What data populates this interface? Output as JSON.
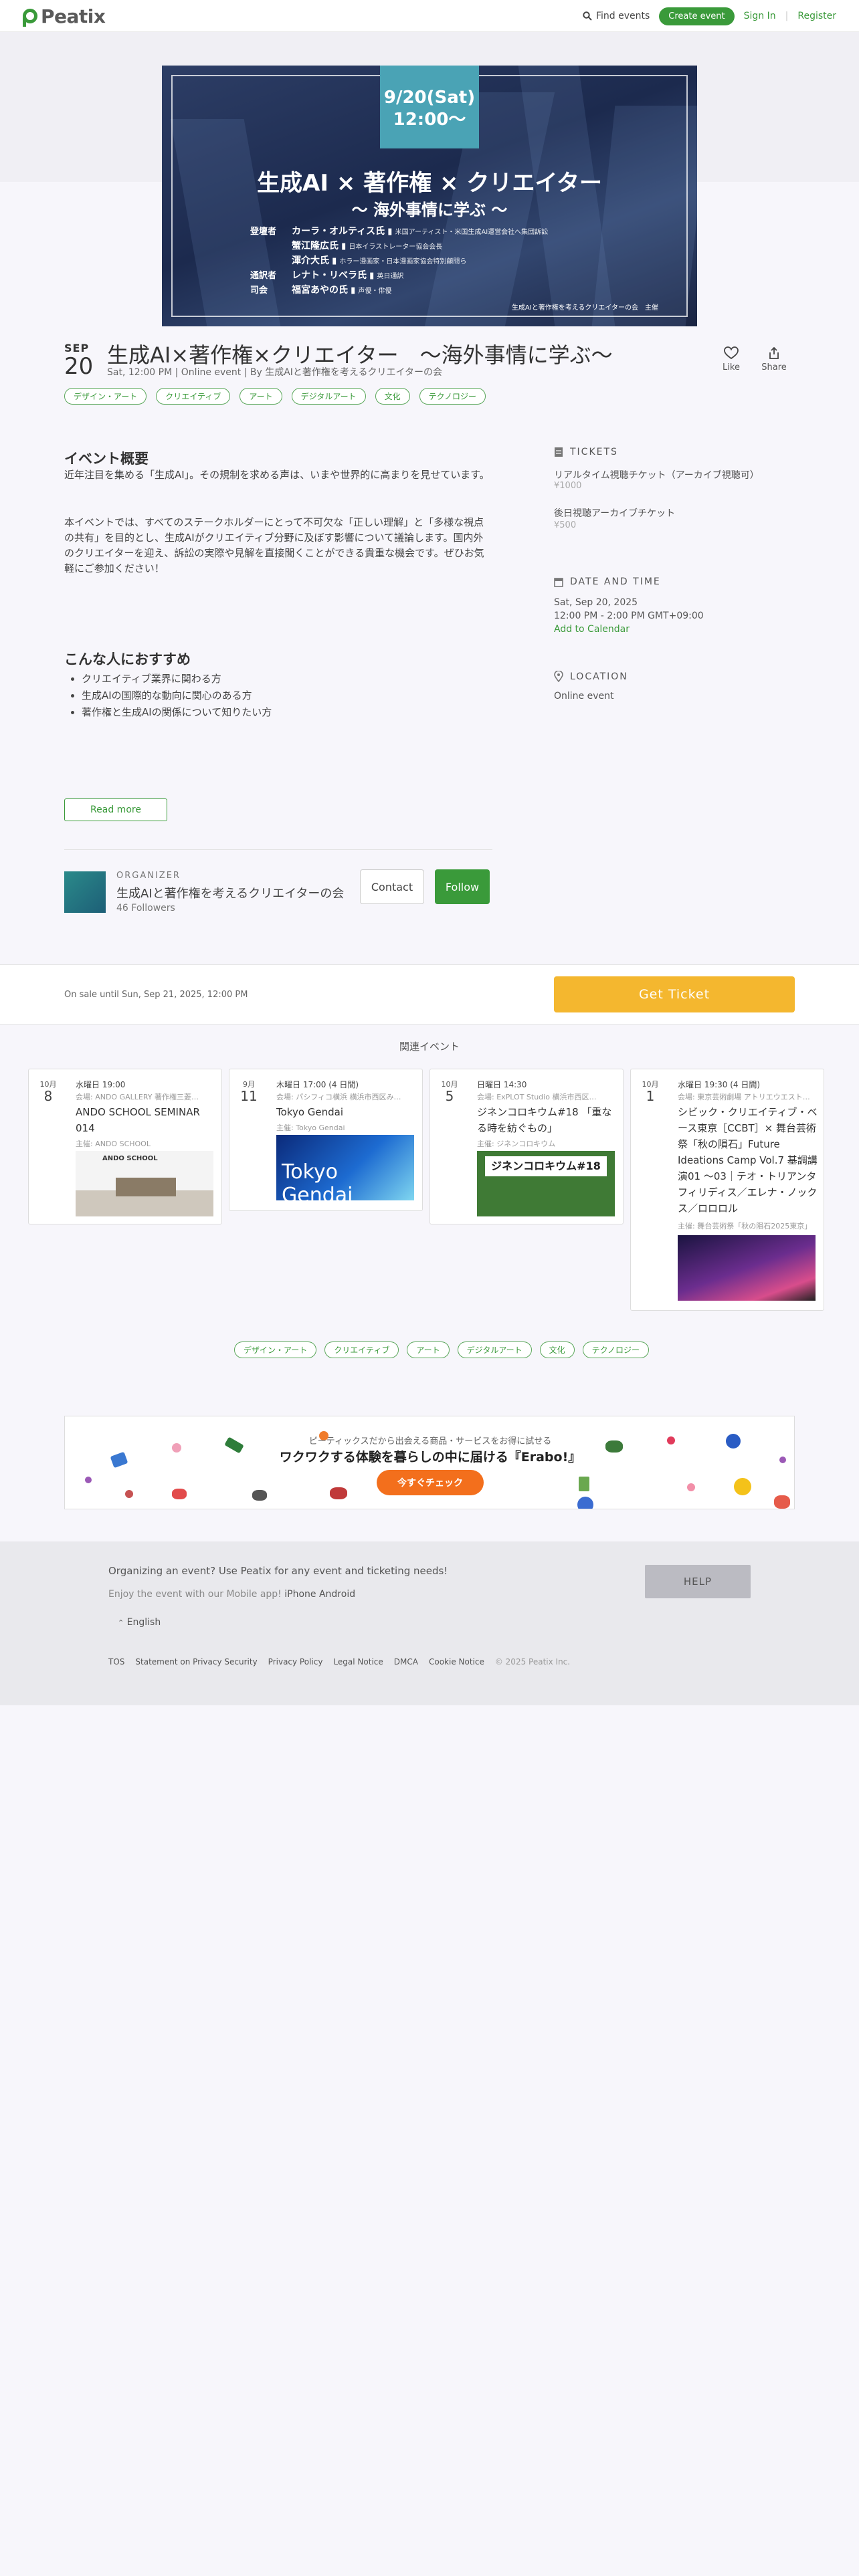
{
  "header": {
    "logo": "Peatix",
    "find_events": "Find events",
    "create_event": "Create event",
    "sign_in": "Sign In",
    "register": "Register"
  },
  "banner": {
    "date": "9/20(Sat)",
    "time": "12:00～",
    "title": "生成AI × 著作権 × クリエイター",
    "subtitle": "～ 海外事情に学ぶ ～",
    "people": [
      {
        "role": "登壇者",
        "name": "カーラ・オルティス氏",
        "aff": "米国アーティスト・米国生成AI運営会社へ集団訴訟"
      },
      {
        "role": "",
        "name": "蟹江隆広氏",
        "aff": "日本イラストレーター協会会長"
      },
      {
        "role": "",
        "name": "渾介大氏",
        "aff": "ホラー漫画家・日本漫画家協会特別顧問ら"
      },
      {
        "role": "通訳者",
        "name": "レナト・リベラ氏",
        "aff": "英日通訳"
      },
      {
        "role": "司会",
        "name": "福宮あやの氏",
        "aff": "声優・俳優"
      }
    ],
    "host": "生成AIと著作権を考えるクリエイターの会　主催"
  },
  "event": {
    "month": "SEP",
    "day": "20",
    "title": "生成AI×著作権×クリエイター　～海外事情に学ぶ～",
    "meta": "Sat, 12:00 PM | Online event | By 生成AIと著作権を考えるクリエイターの会",
    "like": "Like",
    "share": "Share",
    "tags": [
      "デザイン・アート",
      "クリエイティブ",
      "アート",
      "デジタルアート",
      "文化",
      "テクノロジー"
    ]
  },
  "overview": {
    "heading": "イベント概要",
    "p1": "近年注目を集める「生成AI」。その規制を求める声は、いまや世界的に高まりを見せています。",
    "p2": "本イベントでは、すべてのステークホルダーにとって不可欠な「正しい理解」と「多様な視点の共有」を目的とし、生成AIがクリエイティブ分野に及ぼす影響について議論します。国内外のクリエイターを迎え、訴訟の実際や見解を直接聞くことができる貴重な機会です。ぜひお気軽にご参加ください！"
  },
  "recommend": {
    "heading": "こんな人におすすめ",
    "items": [
      "クリエイティブ業界に関わる方",
      "生成AIの国際的な動向に関心のある方",
      "著作権と生成AIの関係について知りたい方"
    ]
  },
  "read_more": "Read more",
  "tickets": {
    "heading": "TICKETS",
    "items": [
      {
        "name": "リアルタイム視聴チケット（アーカイブ視聴可）",
        "price": "¥1000"
      },
      {
        "name": "後日視聴アーカイブチケット",
        "price": "¥500"
      }
    ]
  },
  "datetime": {
    "heading": "DATE AND TIME",
    "date": "Sat, Sep 20, 2025",
    "time": "12:00 PM - 2:00 PM GMT+09:00",
    "add": "Add to Calendar"
  },
  "location": {
    "heading": "LOCATION",
    "value": "Online event"
  },
  "organizer": {
    "label": "ORGANIZER",
    "name": "生成AIと著作権を考えるクリエイターの会",
    "followers": "46 Followers",
    "contact": "Contact",
    "follow": "Follow"
  },
  "sale": {
    "text": "On sale until Sun, Sep 21, 2025, 12:00 PM",
    "button": "Get Ticket"
  },
  "related": {
    "heading": "関連イベント",
    "cards": [
      {
        "month": "10月",
        "day": "8",
        "time": "水曜日 19:00",
        "venue": "会場: ANDO GALLERY 著作権三菱…",
        "name": "ANDO SCHOOL SEMINAR 014",
        "host": "主催: ANDO SCHOOL",
        "img": "ANDO SCHOOL"
      },
      {
        "month": "9月",
        "day": "11",
        "time": "木曜日 17:00 (4 日間)",
        "venue": "会場: パシフィコ横浜 横浜市西区み…",
        "name": "Tokyo Gendai",
        "host": "主催: Tokyo Gendai",
        "img": "Tokyo Gendai"
      },
      {
        "month": "10月",
        "day": "5",
        "time": "日曜日 14:30",
        "venue": "会場: ExPLOT Studio 横浜市西区…",
        "name": "ジネンコロキウム#18 「重なる時を紡ぐもの」",
        "host": "主催: ジネンコロキウム",
        "img": "ジネンコロキウム#18"
      },
      {
        "month": "10月",
        "day": "1",
        "time": "水曜日 19:30 (4 日間)",
        "venue": "会場: 東京芸術劇場 アトリエウエスト…",
        "name": "シビック・クリエイティブ・ベース東京［CCBT］× 舞台芸術祭「秋の隕石」Future Ideations Camp Vol.7 基調講演01 ～03｜テオ・トリアンタフィリディス／エレナ・ノックス／ロロロル",
        "host": "主催: 舞台芸術祭「秋の隕石2025東京」",
        "img": ""
      }
    ]
  },
  "ad": {
    "top": "ピーティックスだから出会える商品・サービスをお得に試せる",
    "main": "ワクワクする体験を暮らしの中に届ける『Erabo!』",
    "button": "今すぐチェック"
  },
  "footer": {
    "organizing": "Organizing an event? Use Peatix for any event and ticketing needs!",
    "enjoy": "Enjoy the event with our Mobile app!",
    "iphone": "iPhone",
    "android": "Android",
    "help": "HELP",
    "language": "English",
    "links": [
      "TOS",
      "Statement on Privacy Security",
      "Privacy Policy",
      "Legal Notice",
      "DMCA",
      "Cookie Notice"
    ],
    "copyright": "© 2025 Peatix Inc."
  },
  "colors": {
    "brand": "#3a9a3a",
    "ticket": "#f4b72f",
    "banner_date": "#4aa3b5"
  }
}
